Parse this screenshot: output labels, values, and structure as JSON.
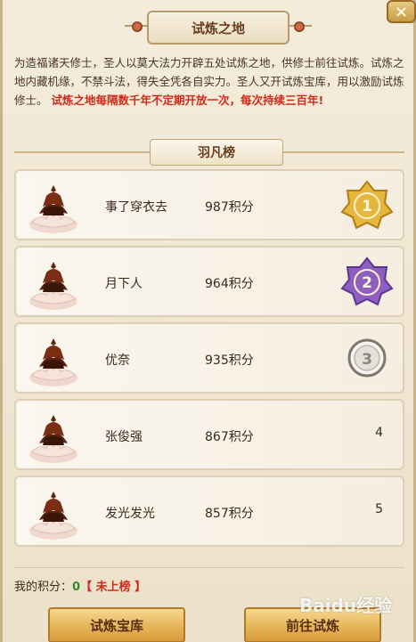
{
  "window": {
    "title": "试炼之地",
    "close_symbol": "×"
  },
  "description": {
    "text": "为造福诸天修士，圣人以莫大法力开辟五处试炼之地，供修士前往试炼。试炼之地内藏机缘，不禁斗法，得失全凭各自实力。圣人又开试炼宝库，用以激励试炼修士。",
    "highlight": "试炼之地每隔数千年不定期开放一次，每次持续三百年!"
  },
  "leaderboard": {
    "title": "羽凡榜",
    "rows": [
      {
        "name": "事了穿衣去",
        "score": "987积分",
        "rank": "1",
        "badge": "gold"
      },
      {
        "name": "月下人",
        "score": "964积分",
        "rank": "2",
        "badge": "purple"
      },
      {
        "name": "优奈",
        "score": "935积分",
        "rank": "3",
        "badge": "silver"
      },
      {
        "name": "张俊强",
        "score": "867积分",
        "rank": "4",
        "badge": "none"
      },
      {
        "name": "发光发光",
        "score": "857积分",
        "rank": "5",
        "badge": "none"
      }
    ]
  },
  "my_score": {
    "label": "我的积分：",
    "value": "0",
    "status": "【 未上榜 】"
  },
  "buttons": {
    "treasury": "试炼宝库",
    "go_trial": "前往试炼"
  },
  "watermark": "Baidu经验",
  "colors": {
    "gold": "#e7b63c",
    "purple": "#8f5fc0",
    "silver": "#b9b2a7",
    "red": "#d22a1a"
  }
}
